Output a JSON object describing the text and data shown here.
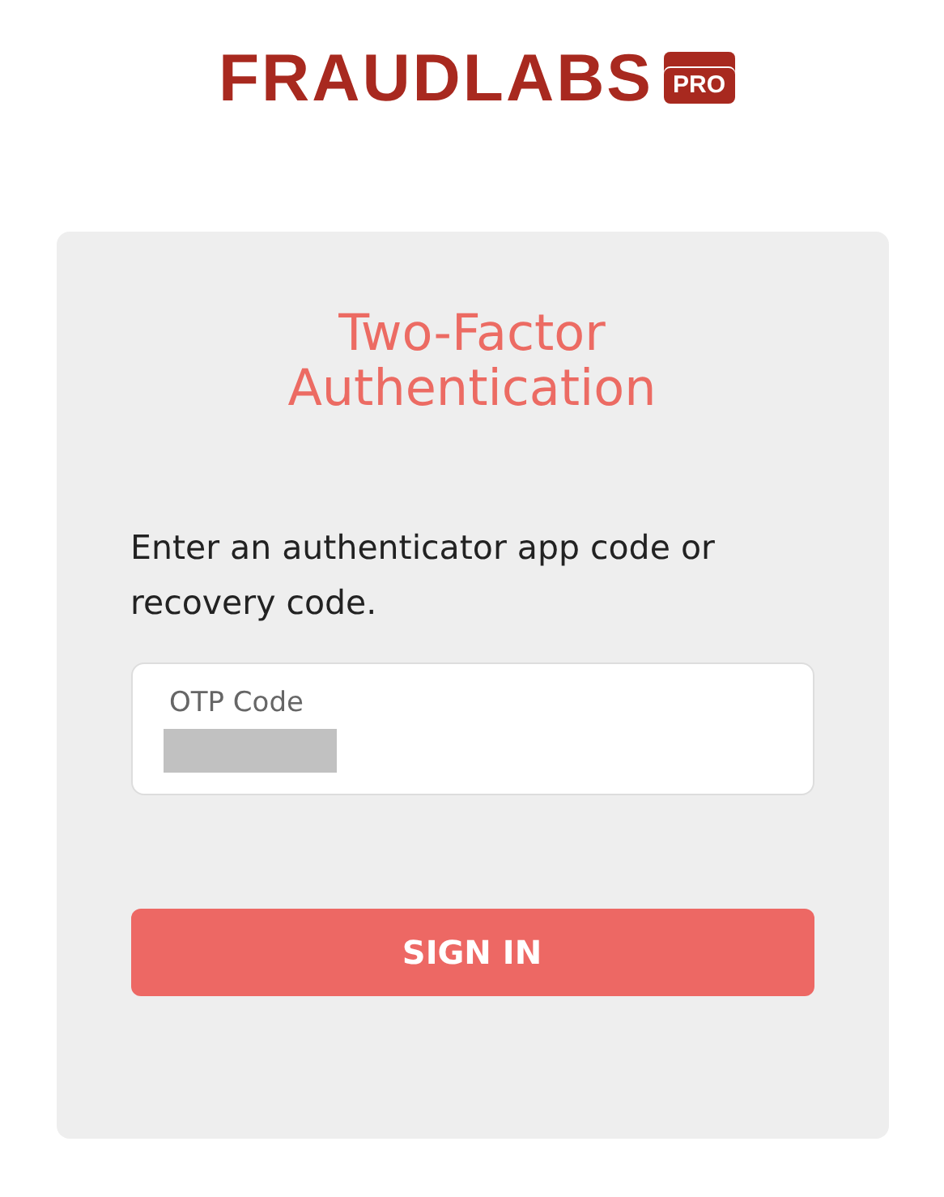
{
  "logo": {
    "name": "FRAUDLABS",
    "badge": "PRO"
  },
  "card": {
    "title": "Two-Factor Authentication",
    "instruction": "Enter an authenticator app code or recovery code.",
    "field": {
      "label": "OTP Code",
      "value_redacted": true
    },
    "button": "SIGN IN"
  }
}
